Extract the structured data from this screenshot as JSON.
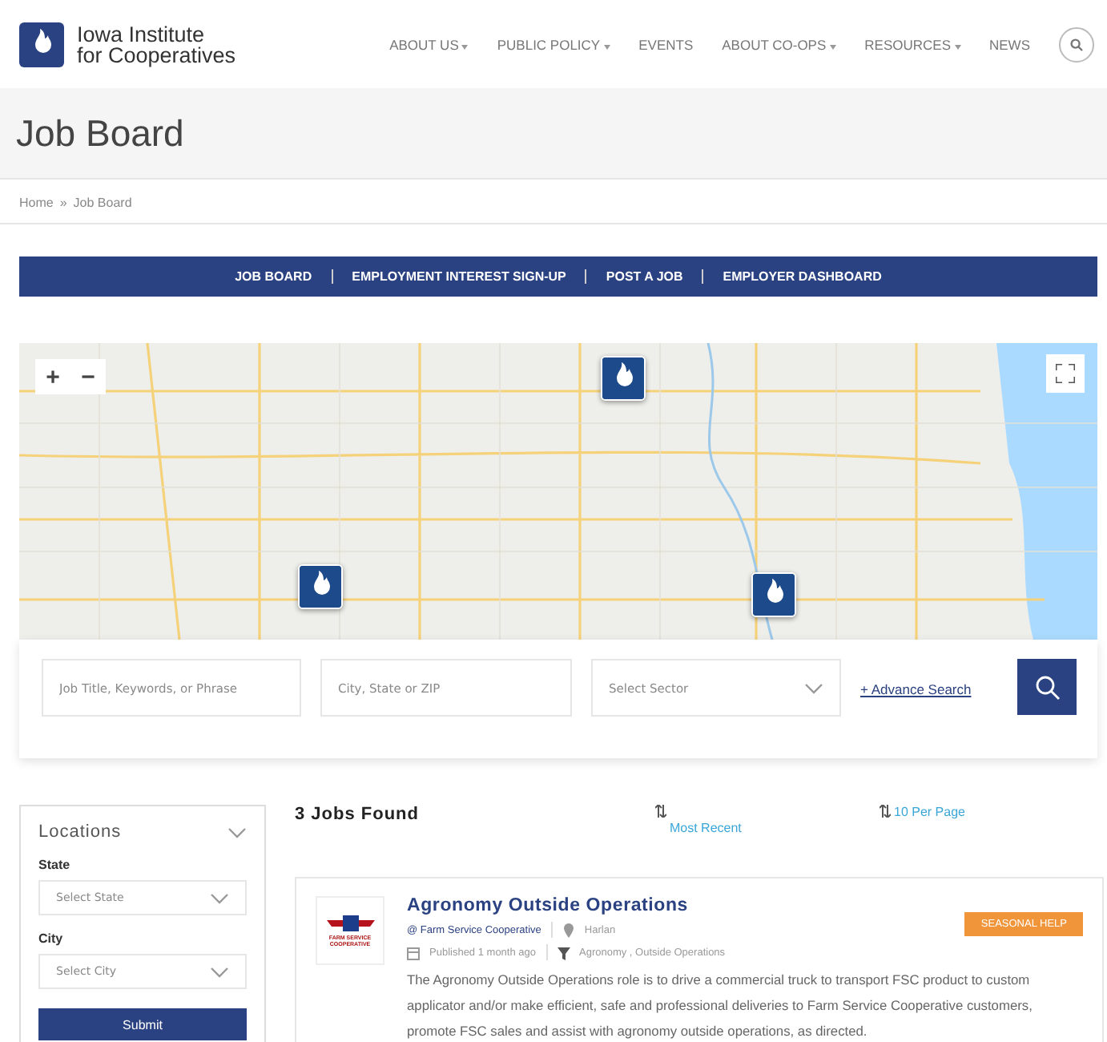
{
  "logo": {
    "line1": "Iowa Institute",
    "line2": "for Cooperatives"
  },
  "nav": [
    {
      "label": "ABOUT US",
      "dropdown": true
    },
    {
      "label": "PUBLIC POLICY",
      "dropdown": true
    },
    {
      "label": "EVENTS",
      "dropdown": false
    },
    {
      "label": "ABOUT CO-OPS",
      "dropdown": true
    },
    {
      "label": "RESOURCES",
      "dropdown": true
    },
    {
      "label": "NEWS",
      "dropdown": false
    }
  ],
  "page_title": "Job Board",
  "breadcrumb": [
    "Home",
    "»",
    "Job Board"
  ],
  "job_nav": [
    "JOB BOARD",
    "EMPLOYMENT INTEREST SIGN-UP",
    "POST A JOB",
    "EMPLOYER DASHBOARD"
  ],
  "map": {
    "zoom_in": "+",
    "zoom_out": "−"
  },
  "search": {
    "keywords": {
      "placeholder": "Job Title, Keywords, or Phrase"
    },
    "location": {
      "placeholder": "City, State or ZIP"
    },
    "sector": {
      "placeholder": "Select Sector"
    },
    "advance_link": "+ Advance Search"
  },
  "sidebar": {
    "title": "Locations",
    "fields": [
      {
        "label": "State",
        "placeholder": "Select State"
      },
      {
        "label": "City",
        "placeholder": "Select City"
      }
    ],
    "submit": "Submit"
  },
  "results": {
    "count": "3 Jobs Found",
    "sort": "Most Recent",
    "per_page": "10 Per Page"
  },
  "jobs": [
    {
      "title": "Agronomy Outside Operations",
      "company": "@ Farm Service Cooperative",
      "location": "Harlan",
      "published": "Published 1 month ago",
      "categories": "Agronomy , Outside Operations",
      "tag": "SEASONAL HELP",
      "description": "The Agronomy Outside Operations role is to drive a commercial truck to transport FSC product to custom applicator and/or make efficient, safe and professional deliveries to Farm Service Cooperative customers, promote FSC sales and assist with agronomy outside operations, as directed.",
      "logo_text": "FARM SERVICE COOPERATIVE"
    }
  ]
}
